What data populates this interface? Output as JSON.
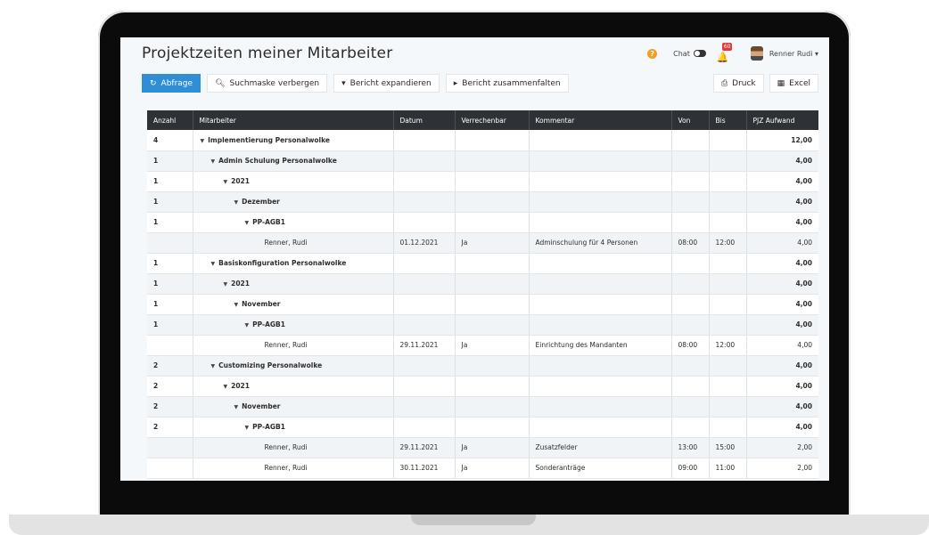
{
  "header": {
    "title": "Projektzeiten meiner Mitarbeiter",
    "chat_label": "Chat",
    "notification_count": "60",
    "user_name": "Renner Rudi ▾"
  },
  "toolbar": {
    "query_label": "Abfrage",
    "hide_search_label": "Suchmaske verbergen",
    "expand_label": "Bericht expandieren",
    "collapse_label": "Bericht zusammenfalten",
    "print_label": "Druck",
    "excel_label": "Excel"
  },
  "table": {
    "columns": [
      "Anzahl",
      "Mitarbeiter",
      "Datum",
      "Verrechenbar",
      "Kommentar",
      "Von",
      "Bis",
      "PJZ Aufwand"
    ],
    "rows": [
      {
        "type": "group",
        "level": 0,
        "count": "4",
        "name": "Implementierung Personalwolke",
        "date": "",
        "billable": "",
        "comment": "",
        "from": "",
        "to": "",
        "effort": "12,00"
      },
      {
        "type": "group",
        "level": 1,
        "count": "1",
        "name": "Admin Schulung Personalwolke",
        "date": "",
        "billable": "",
        "comment": "",
        "from": "",
        "to": "",
        "effort": "4,00"
      },
      {
        "type": "group",
        "level": 2,
        "count": "1",
        "name": "2021",
        "date": "",
        "billable": "",
        "comment": "",
        "from": "",
        "to": "",
        "effort": "4,00"
      },
      {
        "type": "group",
        "level": 3,
        "count": "1",
        "name": "Dezember",
        "date": "",
        "billable": "",
        "comment": "",
        "from": "",
        "to": "",
        "effort": "4,00"
      },
      {
        "type": "group",
        "level": 4,
        "count": "1",
        "name": "PP-AGB1",
        "date": "",
        "billable": "",
        "comment": "",
        "from": "",
        "to": "",
        "effort": "4,00"
      },
      {
        "type": "detail",
        "level": 5,
        "count": "",
        "name": "Renner, Rudi",
        "date": "01.12.2021",
        "billable": "Ja",
        "comment": "Adminschulung für 4 Personen",
        "from": "08:00",
        "to": "12:00",
        "effort": "4,00"
      },
      {
        "type": "group",
        "level": 1,
        "count": "1",
        "name": "Basiskonfiguration Personalwolke",
        "date": "",
        "billable": "",
        "comment": "",
        "from": "",
        "to": "",
        "effort": "4,00"
      },
      {
        "type": "group",
        "level": 2,
        "count": "1",
        "name": "2021",
        "date": "",
        "billable": "",
        "comment": "",
        "from": "",
        "to": "",
        "effort": "4,00"
      },
      {
        "type": "group",
        "level": 3,
        "count": "1",
        "name": "November",
        "date": "",
        "billable": "",
        "comment": "",
        "from": "",
        "to": "",
        "effort": "4,00"
      },
      {
        "type": "group",
        "level": 4,
        "count": "1",
        "name": "PP-AGB1",
        "date": "",
        "billable": "",
        "comment": "",
        "from": "",
        "to": "",
        "effort": "4,00"
      },
      {
        "type": "detail",
        "level": 5,
        "count": "",
        "name": "Renner, Rudi",
        "date": "29.11.2021",
        "billable": "Ja",
        "comment": "Einrichtung des Mandanten",
        "from": "08:00",
        "to": "12:00",
        "effort": "4,00"
      },
      {
        "type": "group",
        "level": 1,
        "count": "2",
        "name": "Customizing Personalwolke",
        "date": "",
        "billable": "",
        "comment": "",
        "from": "",
        "to": "",
        "effort": "4,00"
      },
      {
        "type": "group",
        "level": 2,
        "count": "2",
        "name": "2021",
        "date": "",
        "billable": "",
        "comment": "",
        "from": "",
        "to": "",
        "effort": "4,00"
      },
      {
        "type": "group",
        "level": 3,
        "count": "2",
        "name": "November",
        "date": "",
        "billable": "",
        "comment": "",
        "from": "",
        "to": "",
        "effort": "4,00"
      },
      {
        "type": "group",
        "level": 4,
        "count": "2",
        "name": "PP-AGB1",
        "date": "",
        "billable": "",
        "comment": "",
        "from": "",
        "to": "",
        "effort": "4,00"
      },
      {
        "type": "detail",
        "level": 5,
        "count": "",
        "name": "Renner, Rudi",
        "date": "29.11.2021",
        "billable": "Ja",
        "comment": "Zusatzfelder",
        "from": "13:00",
        "to": "15:00",
        "effort": "2,00"
      },
      {
        "type": "detail",
        "level": 5,
        "count": "",
        "name": "Renner, Rudi",
        "date": "30.11.2021",
        "billable": "Ja",
        "comment": "Sonderanträge",
        "from": "09:00",
        "to": "11:00",
        "effort": "2,00"
      }
    ]
  }
}
